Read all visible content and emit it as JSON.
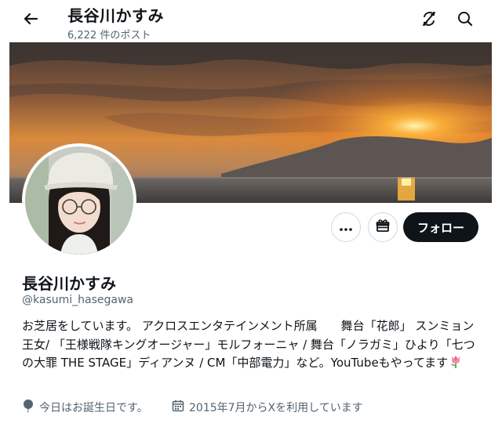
{
  "header": {
    "back_icon": "arrow-left-icon",
    "title": "長谷川かすみ",
    "post_count": "6,222 件のポスト",
    "translate_icon": "no-translate-icon",
    "search_icon": "search-icon"
  },
  "profile": {
    "banner": "sunset-over-sea-photo",
    "avatar": "profile-photo",
    "display_name": "長谷川かすみ",
    "handle": "@kasumi_hasegawa",
    "bio": "お芝居をしています。 アクロスエンタテインメント所属　　舞台「花郎」 スンミョン王女/ 「王様戦隊キングオージャー」モルフォーニャ / 舞台「ノラガミ」ひより「七つの大罪 THE STAGE」ディアンヌ / CM「中部電力」など。YouTubeもやってます",
    "bio_emoji": "tulip-emoji",
    "birthday": "今日はお誕生日です。",
    "joined": "2015年7月からXを利用しています"
  },
  "actions": {
    "more_icon": "more-icon",
    "gift_icon": "gift-icon",
    "follow_label": "フォロー"
  },
  "colors": {
    "text_primary": "#0f1419",
    "text_secondary": "#536471",
    "button_dark": "#0f1419",
    "border": "#cfd9de"
  }
}
